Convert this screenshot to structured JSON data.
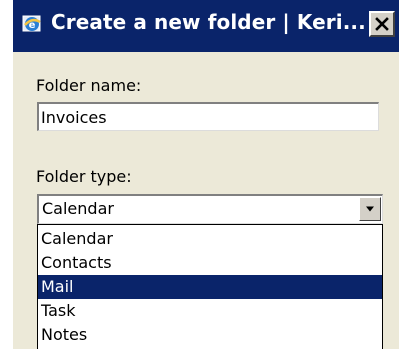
{
  "window": {
    "title": "Create a new folder | Keri...",
    "close_symbol": "✕",
    "icon": "browser-icon"
  },
  "form": {
    "folder_name_label": "Folder name:",
    "folder_name_value": "Invoices",
    "folder_type_label": "Folder type:",
    "folder_type_value": "Calendar",
    "folder_type_options": [
      "Calendar",
      "Contacts",
      "Mail",
      "Task",
      "Notes"
    ],
    "highlighted_option": "Mail"
  },
  "colors": {
    "titlebar": "#0a246a",
    "dialog_background": "#ece9d8",
    "selection": "#0a246a"
  }
}
